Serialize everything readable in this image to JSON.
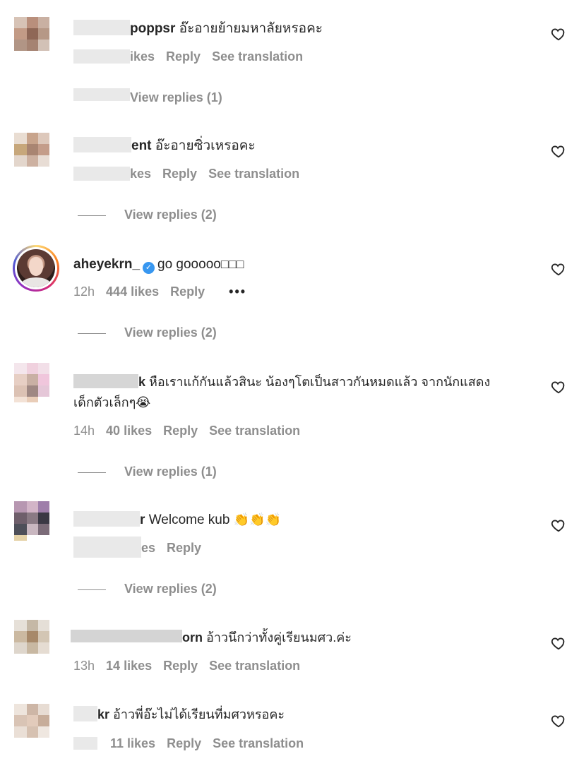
{
  "labels": {
    "reply": "Reply",
    "see_translation": "See translation"
  },
  "comments": [
    {
      "username_visible": "poppsr",
      "text": "อ๊ะอายย้ายมหาลัยหรอคะ",
      "likes": "ikes",
      "view_replies": "View replies (1)"
    },
    {
      "username_visible": "ent",
      "text": "อ๊ะอายซิ่วเหรอคะ",
      "likes": "kes",
      "view_replies": "View replies (2)"
    },
    {
      "username_visible": "aheyekrn_",
      "text": "go gooooo",
      "emoji": "□□□",
      "time": "12h",
      "likes": "444 likes",
      "more": "•••",
      "view_replies": "View replies (2)"
    },
    {
      "username_visible": "k",
      "text_line1": "หือเราแก้กันแล้วสินะ น้องๆโตเป็นสาวกันหมดแล้ว จากนักแสดง",
      "text_line2": "เด็กตัวเล็กๆ",
      "emoji": "😭",
      "time": "14h",
      "likes": "40 likes",
      "view_replies": "View replies (1)"
    },
    {
      "username_visible": "r",
      "text": "Welcome kub",
      "emoji": "👏👏👏",
      "likes": "es",
      "view_replies": "View replies (2)"
    },
    {
      "username_visible": "orn",
      "text": "อ้าวนึกว่าทั้งคู่เรียนมศว.ค่ะ",
      "time": "13h",
      "likes": "14 likes"
    },
    {
      "username_visible": "kr",
      "text": "อ้าวพี่อ๊ะไม่ได้เรียนที่มศวหรอคะ",
      "likes": "11 likes"
    }
  ]
}
